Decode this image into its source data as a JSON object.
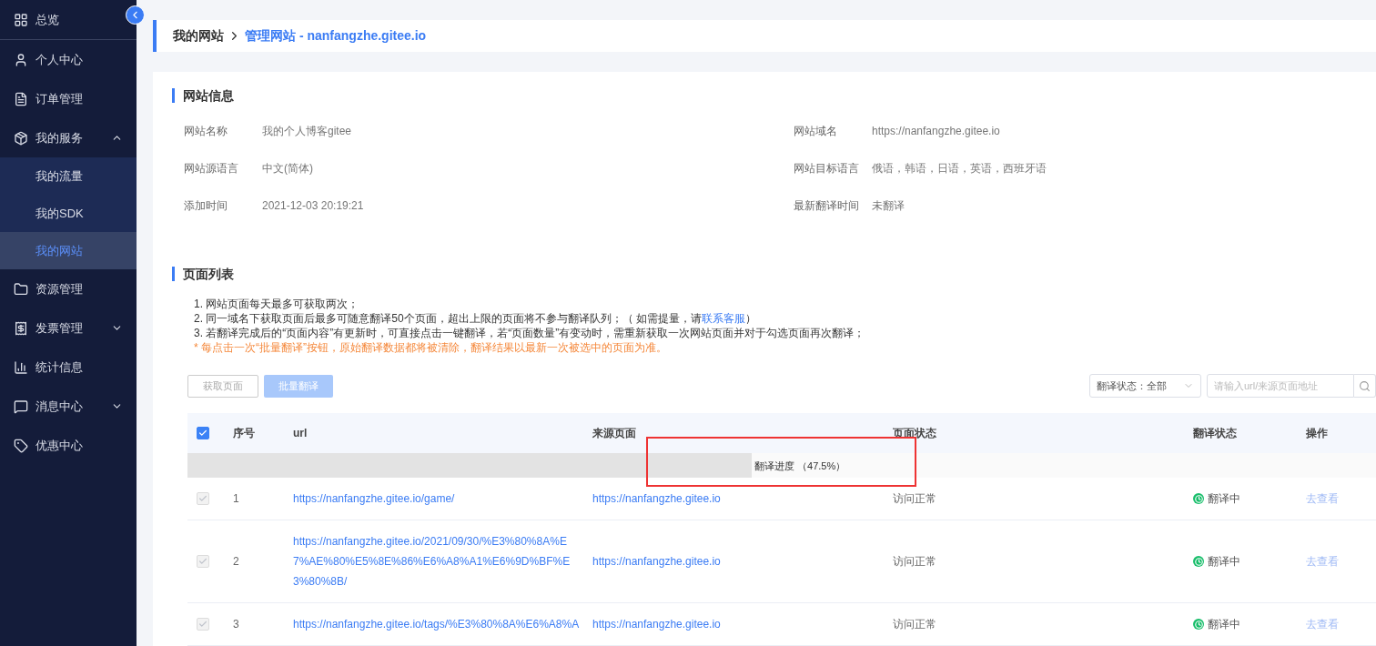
{
  "sidebar": {
    "items": [
      {
        "label": "总览",
        "selected": false
      },
      {
        "label": "个人中心",
        "selected": false
      },
      {
        "label": "订单管理",
        "selected": false
      },
      {
        "label": "我的服务",
        "selected": false,
        "expanded": true,
        "children": [
          {
            "label": "我的流量",
            "selected": false
          },
          {
            "label": "我的SDK",
            "selected": false
          },
          {
            "label": "我的网站",
            "selected": true
          }
        ]
      },
      {
        "label": "资源管理",
        "selected": false
      },
      {
        "label": "发票管理",
        "selected": false,
        "expanded": false
      },
      {
        "label": "统计信息",
        "selected": false
      },
      {
        "label": "消息中心",
        "selected": false,
        "expanded": false
      },
      {
        "label": "优惠中心",
        "selected": false
      }
    ]
  },
  "breadcrumb": [
    {
      "label": "我的网站",
      "selected": false
    },
    {
      "label": "管理网站 - nanfangzhe.gitee.io",
      "selected": true
    }
  ],
  "site_info": {
    "title": "网站信息",
    "fields": [
      {
        "label": "网站名称",
        "value": "我的个人博客gitee"
      },
      {
        "label": "网站域名",
        "value": "https://nanfangzhe.gitee.io"
      },
      {
        "label": "网站源语言",
        "value": "中文(简体)"
      },
      {
        "label": "网站目标语言",
        "value": "俄语，韩语，日语，英语，西班牙语"
      },
      {
        "label": "添加时间",
        "value": "2021-12-03 20:19:21"
      },
      {
        "label": "最新翻译时间",
        "value": "未翻译"
      }
    ]
  },
  "page_list": {
    "title": "页面列表",
    "notes": [
      {
        "kind": "rule",
        "text": "1. 网站页面每天最多可获取两次；"
      },
      {
        "kind": "rule",
        "text": "2. 同一域名下获取页面后最多可随意翻译50个页面，超出上限的页面将不参与翻译队列；（ 如需提量，请",
        "link": "联系客服",
        "after": "）"
      },
      {
        "kind": "rule",
        "text": "3. 若翻译完成后的“页面内容”有更新时，可直接点击一键翻译，若“页面数量”有变动时，需重新获取一次网站页面并对于勾选页面再次翻译；"
      },
      {
        "kind": "warning",
        "text": "* 每点击一次“批量翻译”按钮，原始翻译数据都将被清除，翻译结果以最新一次被选中的页面为准。"
      }
    ],
    "buttons": [
      {
        "label": "获取页面",
        "disabled": true,
        "kind": "outline"
      },
      {
        "label": "批量翻译",
        "disabled": true,
        "kind": "primary"
      }
    ],
    "filter": {
      "value": "翻译状态：全部"
    },
    "search": {
      "placeholder": "请输入url/来源页面地址"
    },
    "table": {
      "header_checked": true,
      "columns": [
        "序号",
        "url",
        "来源页面",
        "页面状态",
        "翻译状态",
        "操作"
      ],
      "progress": {
        "label": "翻译进度 （47.5%）",
        "level": 0.475
      },
      "rows": [
        {
          "checked": true,
          "disabled": true,
          "index": "1",
          "url": "https://nanfangzhe.gitee.io/game/",
          "source": "https://nanfangzhe.gitee.io",
          "page_status": "访问正常",
          "status": {
            "label": "翻译中",
            "color": "#19be6b"
          },
          "action": "去查看"
        },
        {
          "checked": true,
          "disabled": true,
          "index": "2",
          "url": "https://nanfangzhe.gitee.io/2021/09/30/%E3%80%8A%E7%AE%80%E5%8E%86%E6%A8%A1%E6%9D%BF%E3%80%8B/",
          "source": "https://nanfangzhe.gitee.io",
          "page_status": "访问正常",
          "status": {
            "label": "翻译中",
            "color": "#19be6b"
          },
          "action": "去查看"
        },
        {
          "checked": true,
          "disabled": true,
          "index": "3",
          "url": "https://nanfangzhe.gitee.io/tags/%E3%80%8A%E6%A8%A",
          "source": "https://nanfangzhe.gitee.io",
          "page_status": "访问正常",
          "status": {
            "label": "翻译中",
            "color": "#19be6b"
          },
          "action": "去查看"
        }
      ]
    }
  }
}
